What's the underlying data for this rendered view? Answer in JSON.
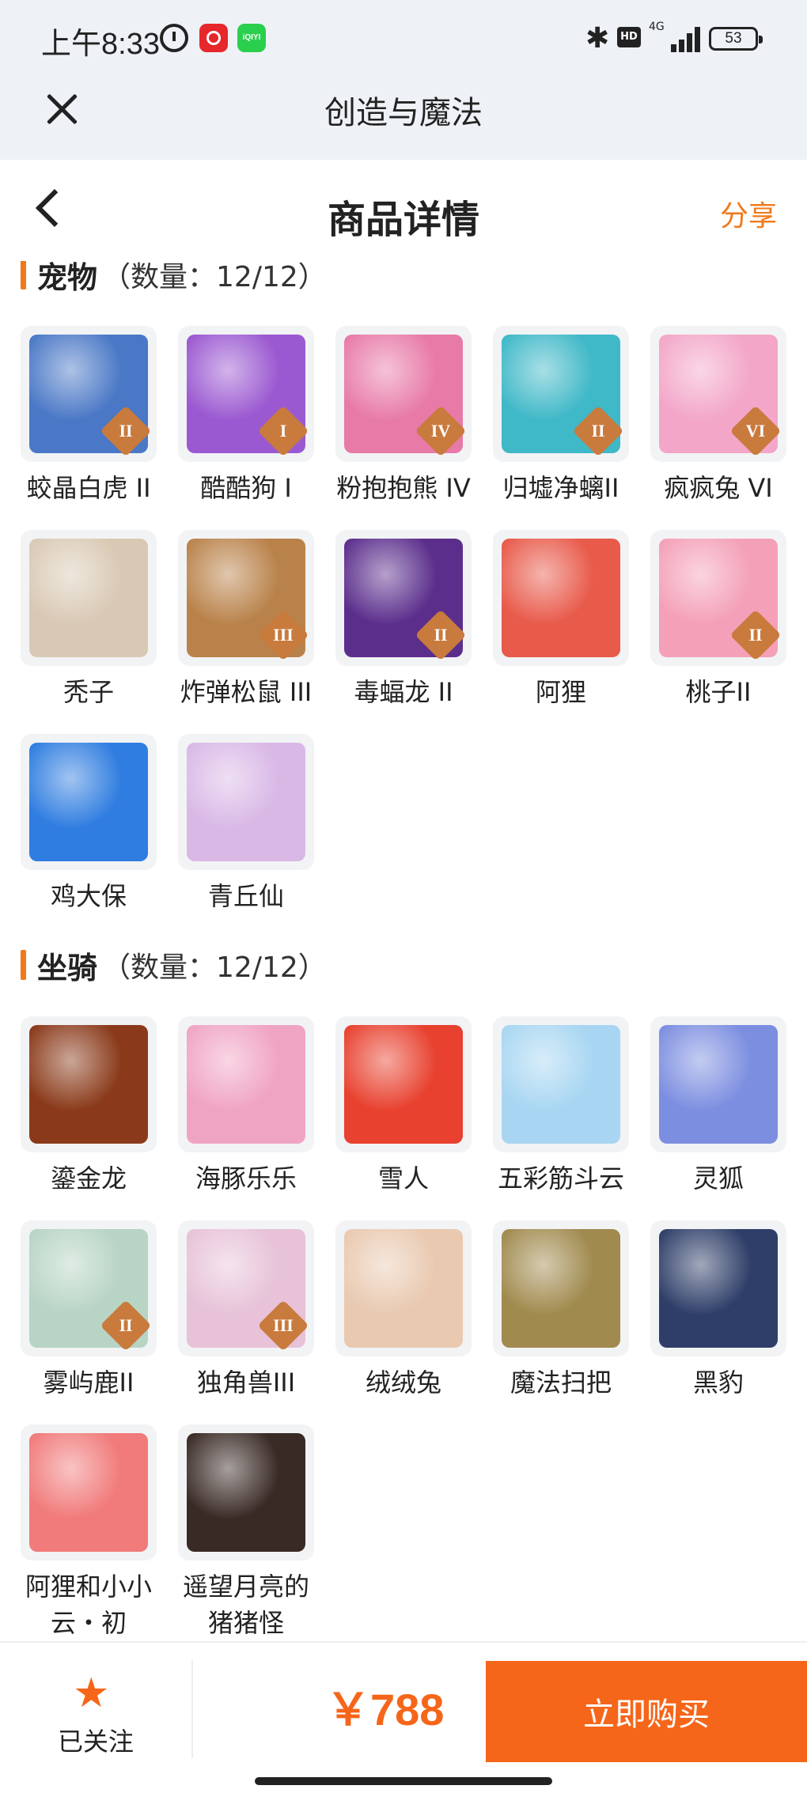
{
  "status_bar": {
    "time": "上午8:33",
    "app2_label": "iQIYI",
    "bt_glyph": "✱",
    "hd": "HD",
    "network": "4G",
    "battery": "53"
  },
  "app_bar": {
    "title": "创造与魔法"
  },
  "nav": {
    "title": "商品详情",
    "share": "分享"
  },
  "sections": {
    "pets": {
      "name": "宠物",
      "count": "（数量：12/12）",
      "items": [
        {
          "name": "蛟晶白虎 II",
          "tier": "II",
          "color": "#4a78c6"
        },
        {
          "name": "酷酷狗 I",
          "tier": "I",
          "color": "#9b59d1"
        },
        {
          "name": "粉抱抱熊 IV",
          "tier": "IV",
          "color": "#e87aa8"
        },
        {
          "name": "归墟净螭II",
          "tier": "II",
          "color": "#3fb8c7"
        },
        {
          "name": "疯疯兔 VI",
          "tier": "VI",
          "color": "#f3a6c8"
        },
        {
          "name": "秃子",
          "tier": "",
          "color": "#d9c9b4"
        },
        {
          "name": "炸弹松鼠 III",
          "tier": "III",
          "color": "#b9824a"
        },
        {
          "name": "毒蝠龙 II",
          "tier": "II",
          "color": "#5b2e8c"
        },
        {
          "name": "阿狸",
          "tier": "",
          "color": "#e85a4a"
        },
        {
          "name": "桃子II",
          "tier": "II",
          "color": "#f4a0b8"
        },
        {
          "name": "鸡大保",
          "tier": "",
          "color": "#2f7de0"
        },
        {
          "name": "青丘仙",
          "tier": "",
          "color": "#d9b8e6"
        }
      ]
    },
    "mounts": {
      "name": "坐骑",
      "count": "（数量：12/12）",
      "items": [
        {
          "name": "鎏金龙",
          "tier": "",
          "color": "#8a3a1a"
        },
        {
          "name": "海豚乐乐",
          "tier": "",
          "color": "#f0a4c4"
        },
        {
          "name": "雪人",
          "tier": "",
          "color": "#e8412f"
        },
        {
          "name": "五彩筋斗云",
          "tier": "",
          "color": "#a8d6f2"
        },
        {
          "name": "灵狐",
          "tier": "",
          "color": "#7c8ee0"
        },
        {
          "name": "雾屿鹿II",
          "tier": "II",
          "color": "#b7d4c4"
        },
        {
          "name": "独角兽III",
          "tier": "III",
          "color": "#e7c2d8"
        },
        {
          "name": "绒绒兔",
          "tier": "",
          "color": "#e9c9b0"
        },
        {
          "name": "魔法扫把",
          "tier": "",
          "color": "#a08a4e"
        },
        {
          "name": "黑豹",
          "tier": "",
          "color": "#2e3e68"
        },
        {
          "name": "阿狸和小小云・初",
          "tier": "",
          "color": "#f17a7a"
        },
        {
          "name": "遥望月亮的猪猪怪",
          "tier": "",
          "color": "#3a2a26"
        }
      ]
    }
  },
  "bottom": {
    "star_glyph": "★",
    "follow": "已关注",
    "price": "￥788",
    "buy": "立即购买"
  }
}
